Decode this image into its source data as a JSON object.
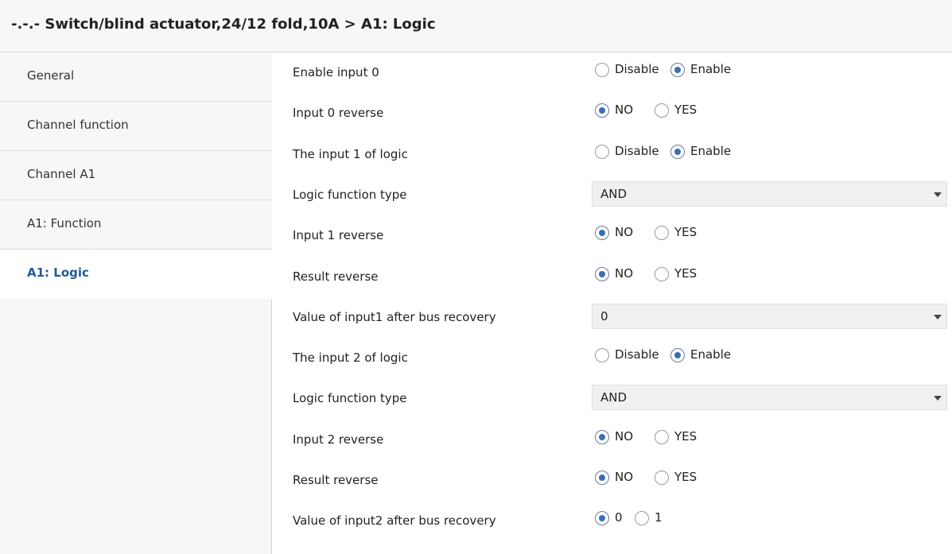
{
  "header": {
    "title": "-.-.- Switch/blind actuator,24/12 fold,10A > A1: Logic"
  },
  "sidebar": {
    "items": [
      {
        "label": "General"
      },
      {
        "label": "Channel function"
      },
      {
        "label": "Channel A1"
      },
      {
        "label": "A1: Function"
      },
      {
        "label": "A1: Logic",
        "active": true
      }
    ]
  },
  "params": [
    {
      "label": "Enable input 0",
      "type": "radio",
      "options": [
        "Disable",
        "Enable"
      ],
      "selected": "Enable"
    },
    {
      "label": "Input 0 reverse",
      "type": "radio",
      "options": [
        "NO",
        "YES"
      ],
      "selected": "NO"
    },
    {
      "label": "The input 1 of logic",
      "type": "radio",
      "options": [
        "Disable",
        "Enable"
      ],
      "selected": "Enable"
    },
    {
      "label": "Logic function type",
      "type": "select",
      "value": "AND"
    },
    {
      "label": "Input 1 reverse",
      "type": "radio",
      "options": [
        "NO",
        "YES"
      ],
      "selected": "NO"
    },
    {
      "label": "Result reverse",
      "type": "radio",
      "options": [
        "NO",
        "YES"
      ],
      "selected": "NO"
    },
    {
      "label": "Value of input1 after bus recovery",
      "type": "select",
      "value": "0"
    },
    {
      "label": "The input 2 of logic",
      "type": "radio",
      "options": [
        "Disable",
        "Enable"
      ],
      "selected": "Enable"
    },
    {
      "label": "Logic function type",
      "type": "select",
      "value": "AND"
    },
    {
      "label": "Input 2 reverse",
      "type": "radio",
      "options": [
        "NO",
        "YES"
      ],
      "selected": "NO"
    },
    {
      "label": "Result reverse",
      "type": "radio",
      "options": [
        "NO",
        "YES"
      ],
      "selected": "NO"
    },
    {
      "label": "Value of input2 after bus recovery",
      "type": "radio",
      "options": [
        "0",
        "1"
      ],
      "selected": "0"
    }
  ],
  "colors": {
    "accent": "#1f5c99",
    "radio_dot": "#3e6db5"
  }
}
